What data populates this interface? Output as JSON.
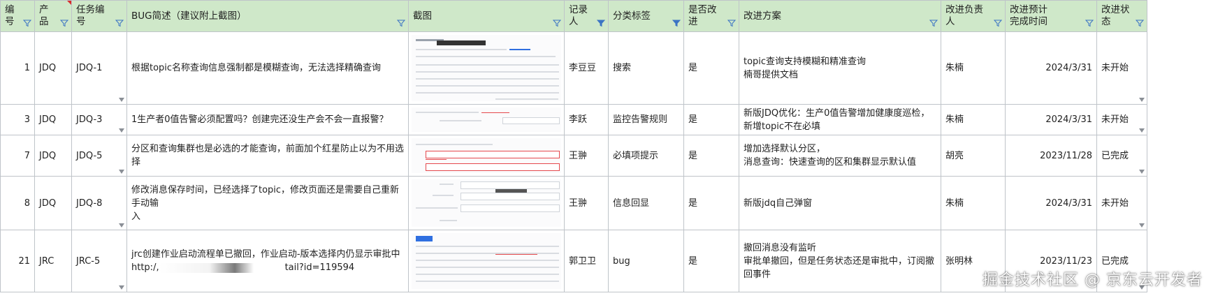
{
  "columns": [
    {
      "label": "编号",
      "filter_active": false
    },
    {
      "label": "产品",
      "filter_active": false
    },
    {
      "label": "任务编号",
      "filter_active": false
    },
    {
      "label": "BUG简述（建议附上截图）",
      "filter_active": false
    },
    {
      "label": "截图",
      "filter_active": false
    },
    {
      "label": "记录人",
      "filter_active": true
    },
    {
      "label": "分类标签",
      "filter_active": true
    },
    {
      "label": "是否改进",
      "filter_active": false
    },
    {
      "label": "改进方案",
      "filter_active": false
    },
    {
      "label": "改进负责人",
      "filter_active": false
    },
    {
      "label": "改进预计完成时间",
      "label_line1": "改进预计",
      "label_line2": "完成时间",
      "filter_active": false
    },
    {
      "label": "改进状态",
      "filter_active": false
    }
  ],
  "rows": [
    {
      "id": "1",
      "product": "JDQ",
      "task": "JDQ-1",
      "desc": [
        "根据topic名称查询信息强制都是模糊查询，无法选择精确查询"
      ],
      "recorder": "李豆豆",
      "tag": "搜索",
      "improve": "是",
      "plan": [
        "topic查询支持模糊和精准查询",
        "楠哥提供文档"
      ],
      "owner": "朱楠",
      "date": "2024/3/31",
      "status": "未开始"
    },
    {
      "id": "3",
      "product": "JDQ",
      "task": "JDQ-3",
      "desc": [
        "1生产者0值告警必须配置吗？创建完还没生产会不会一直报警？"
      ],
      "recorder": "李跃",
      "tag": "监控告警规则",
      "improve": "是",
      "plan": [
        "新版JDQ优化：生产0值告警增加健康度巡检，",
        "新增topic不在必填"
      ],
      "owner": "朱楠",
      "date": "2024/3/31",
      "status": "未开始"
    },
    {
      "id": "7",
      "product": "JDQ",
      "task": "JDQ-5",
      "desc": [
        "分区和查询集群也是必选的才能查询，前面加个红星防止以为不用选择"
      ],
      "recorder": "王翀",
      "tag": "必填项提示",
      "improve": "是",
      "plan": [
        "增加选择默认分区，",
        "消息查询：快速查询的区和集群显示默认值"
      ],
      "owner": "胡亮",
      "date": "2023/11/28",
      "status": "已完成"
    },
    {
      "id": "8",
      "product": "JDQ",
      "task": "JDQ-8",
      "desc": [
        "修改消息保存时间，已经选择了topic，修改页面还是需要自己重新手动输",
        "入"
      ],
      "recorder": "王翀",
      "tag": "信息回显",
      "improve": "是",
      "plan": [
        "新版jdq自己弹窗"
      ],
      "owner": "朱楠",
      "date": "2024/3/31",
      "status": "未开始"
    },
    {
      "id": "21",
      "product": "JRC",
      "task": "JRC-5",
      "desc": [
        "jrc创建作业启动流程单已撤回，作业启动-版本选择内仍显示审批中",
        "http:/,",
        "tail?id=119594"
      ],
      "recorder": "郭卫卫",
      "tag": "bug",
      "improve": "是",
      "plan": [
        "撤回消息没有监听",
        "审批单撤回，但是任务状态还是审批中，订阅撤",
        "回事件"
      ],
      "owner": "张明林",
      "date": "2023/11/23",
      "status": "已完成"
    }
  ],
  "watermark": "掘金技术社区 @ 京东云开发者",
  "colors": {
    "header_bg": "#cfe8c9",
    "grid": "#bfc4c9",
    "filter_icon": "#3b74c4",
    "accent_red": "#d92b2b"
  }
}
